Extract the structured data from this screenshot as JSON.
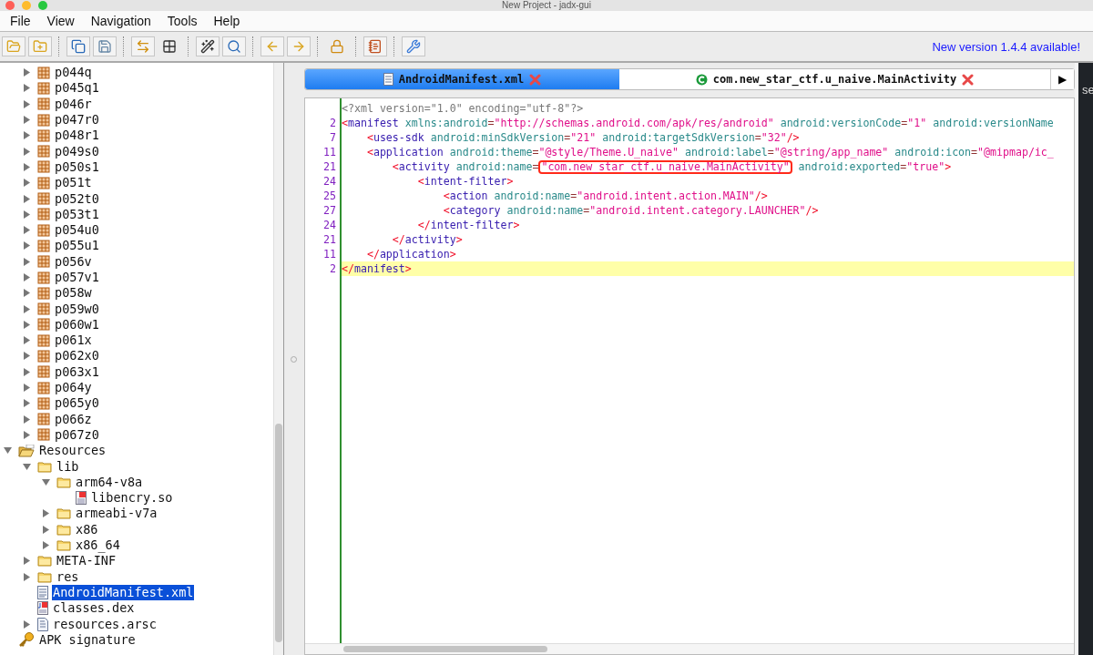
{
  "window": {
    "title": "New Project - jadx-gui"
  },
  "menu": [
    "File",
    "View",
    "Navigation",
    "Tools",
    "Help"
  ],
  "update_notice": "New version 1.4.4 available!",
  "packages": [
    {
      "label": "p044q",
      "expanded": false
    },
    {
      "label": "p045q1",
      "expanded": false
    },
    {
      "label": "p046r",
      "expanded": false
    },
    {
      "label": "p047r0",
      "expanded": false
    },
    {
      "label": "p048r1",
      "expanded": false
    },
    {
      "label": "p049s0",
      "expanded": false
    },
    {
      "label": "p050s1",
      "expanded": false
    },
    {
      "label": "p051t",
      "expanded": false
    },
    {
      "label": "p052t0",
      "expanded": false
    },
    {
      "label": "p053t1",
      "expanded": false
    },
    {
      "label": "p054u0",
      "expanded": false
    },
    {
      "label": "p055u1",
      "expanded": false
    },
    {
      "label": "p056v",
      "expanded": false
    },
    {
      "label": "p057v1",
      "expanded": false
    },
    {
      "label": "p058w",
      "expanded": false
    },
    {
      "label": "p059w0",
      "expanded": false
    },
    {
      "label": "p060w1",
      "expanded": false
    },
    {
      "label": "p061x",
      "expanded": false
    },
    {
      "label": "p062x0",
      "expanded": false
    },
    {
      "label": "p063x1",
      "expanded": false
    },
    {
      "label": "p064y",
      "expanded": false
    },
    {
      "label": "p065y0",
      "expanded": false
    },
    {
      "label": "p066z",
      "expanded": false
    },
    {
      "label": "p067z0",
      "expanded": false
    }
  ],
  "tree": [
    {
      "label": "Resources",
      "kind": "resources",
      "expanded": true,
      "selected": false,
      "children": [
        {
          "label": "lib",
          "kind": "folder",
          "expanded": true,
          "selected": false,
          "children": [
            {
              "label": "arm64-v8a",
              "kind": "folder",
              "expanded": true,
              "selected": false,
              "children": [
                {
                  "label": "libencry.so",
                  "kind": "binary",
                  "selected": false
                }
              ]
            },
            {
              "label": "armeabi-v7a",
              "kind": "folder",
              "expanded": false,
              "selected": false
            },
            {
              "label": "x86",
              "kind": "folder",
              "expanded": false,
              "selected": false
            },
            {
              "label": "x86_64",
              "kind": "folder",
              "expanded": false,
              "selected": false
            }
          ]
        },
        {
          "label": "META-INF",
          "kind": "folder",
          "expanded": false,
          "selected": false
        },
        {
          "label": "res",
          "kind": "folder",
          "expanded": false,
          "selected": false
        },
        {
          "label": "AndroidManifest.xml",
          "kind": "xml",
          "selected": true
        },
        {
          "label": "classes.dex",
          "kind": "dex",
          "selected": false
        },
        {
          "label": "resources.arsc",
          "kind": "arsc",
          "expanded": false,
          "selected": false
        }
      ]
    },
    {
      "label": "APK signature",
      "kind": "key",
      "selected": false
    }
  ],
  "tabs": [
    {
      "label": "AndroidManifest.xml",
      "kind": "xml",
      "selected": true
    },
    {
      "label": "com.new_star_ctf.u_naive.MainActivity",
      "kind": "class",
      "selected": false
    }
  ],
  "code": [
    {
      "highlighted": false,
      "tokens": [
        {
          "kind": "decl",
          "text": "<?xml version=\"1.0\" encoding=\"utf-8\"?>"
        }
      ]
    },
    {
      "number": "2",
      "highlighted": false,
      "tokens": [
        {
          "kind": "punct",
          "text": "<"
        },
        {
          "kind": "tag",
          "text": "manifest"
        },
        {
          "kind": "attr",
          "text": " xmlns:android"
        },
        {
          "kind": "eq",
          "text": "="
        },
        {
          "kind": "value",
          "text": "\"http://schemas.android.com/apk/res/android\""
        },
        {
          "kind": "attr",
          "text": " android:versionCode"
        },
        {
          "kind": "eq",
          "text": "="
        },
        {
          "kind": "value",
          "text": "\"1\""
        },
        {
          "kind": "attr",
          "text": " android:versionName"
        }
      ]
    },
    {
      "number": "7",
      "highlighted": false,
      "tokens": [
        {
          "kind": "punct",
          "text": "    <"
        },
        {
          "kind": "tag",
          "text": "uses-sdk"
        },
        {
          "kind": "attr",
          "text": " android:minSdkVersion"
        },
        {
          "kind": "eq",
          "text": "="
        },
        {
          "kind": "value",
          "text": "\"21\""
        },
        {
          "kind": "attr",
          "text": " android:targetSdkVersion"
        },
        {
          "kind": "eq",
          "text": "="
        },
        {
          "kind": "value",
          "text": "\"32\""
        },
        {
          "kind": "punct",
          "text": "/>"
        }
      ]
    },
    {
      "number": "11",
      "highlighted": false,
      "tokens": [
        {
          "kind": "punct",
          "text": "    <"
        },
        {
          "kind": "tag",
          "text": "application"
        },
        {
          "kind": "attr",
          "text": " android:theme"
        },
        {
          "kind": "eq",
          "text": "="
        },
        {
          "kind": "value",
          "text": "\"@style/Theme.U_naive\""
        },
        {
          "kind": "attr",
          "text": " android:label"
        },
        {
          "kind": "eq",
          "text": "="
        },
        {
          "kind": "value",
          "text": "\"@string/app_name\""
        },
        {
          "kind": "attr",
          "text": " android:icon"
        },
        {
          "kind": "eq",
          "text": "="
        },
        {
          "kind": "value",
          "text": "\"@mipmap/ic_"
        }
      ]
    },
    {
      "number": "21",
      "highlighted": false,
      "tokens": [
        {
          "kind": "punct",
          "text": "        <"
        },
        {
          "kind": "tag",
          "text": "activity"
        },
        {
          "kind": "attr",
          "text": " android:name"
        },
        {
          "kind": "eq",
          "text": "="
        },
        {
          "kind": "boxed",
          "text": "\"com.new_star_ctf.u_naive.MainActivity\""
        },
        {
          "kind": "attr",
          "text": " android:exported"
        },
        {
          "kind": "eq",
          "text": "="
        },
        {
          "kind": "value",
          "text": "\"true\""
        },
        {
          "kind": "punct",
          "text": ">"
        }
      ]
    },
    {
      "number": "24",
      "highlighted": false,
      "tokens": [
        {
          "kind": "punct",
          "text": "            <"
        },
        {
          "kind": "tag",
          "text": "intent-filter"
        },
        {
          "kind": "punct",
          "text": ">"
        }
      ]
    },
    {
      "number": "25",
      "highlighted": false,
      "tokens": [
        {
          "kind": "punct",
          "text": "                <"
        },
        {
          "kind": "tag",
          "text": "action"
        },
        {
          "kind": "attr",
          "text": " android:name"
        },
        {
          "kind": "eq",
          "text": "="
        },
        {
          "kind": "value",
          "text": "\"android.intent.action.MAIN\""
        },
        {
          "kind": "punct",
          "text": "/>"
        }
      ]
    },
    {
      "number": "27",
      "highlighted": false,
      "tokens": [
        {
          "kind": "punct",
          "text": "                <"
        },
        {
          "kind": "tag",
          "text": "category"
        },
        {
          "kind": "attr",
          "text": " android:name"
        },
        {
          "kind": "eq",
          "text": "="
        },
        {
          "kind": "value",
          "text": "\"android.intent.category.LAUNCHER\""
        },
        {
          "kind": "punct",
          "text": "/>"
        }
      ]
    },
    {
      "number": "24",
      "highlighted": false,
      "tokens": [
        {
          "kind": "punct",
          "text": "            </"
        },
        {
          "kind": "tag",
          "text": "intent-filter"
        },
        {
          "kind": "punct",
          "text": ">"
        }
      ]
    },
    {
      "number": "21",
      "highlighted": false,
      "tokens": [
        {
          "kind": "punct",
          "text": "        </"
        },
        {
          "kind": "tag",
          "text": "activity"
        },
        {
          "kind": "punct",
          "text": ">"
        }
      ]
    },
    {
      "number": "11",
      "highlighted": false,
      "tokens": [
        {
          "kind": "punct",
          "text": "    </"
        },
        {
          "kind": "tag",
          "text": "application"
        },
        {
          "kind": "punct",
          "text": ">"
        }
      ]
    },
    {
      "number": "2",
      "highlighted": true,
      "tokens": [
        {
          "kind": "punct",
          "text": "</"
        },
        {
          "kind": "tag",
          "text": "manifest"
        },
        {
          "kind": "punct",
          "text": ">"
        }
      ]
    }
  ],
  "tab_scroll_arrow": "▶",
  "desktop_text": "se"
}
